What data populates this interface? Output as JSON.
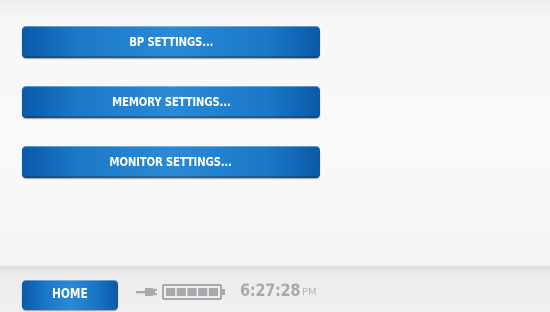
{
  "menu": {
    "bp_settings_label": "BP SETTINGS...",
    "memory_settings_label": "MEMORY SETTINGS...",
    "monitor_settings_label": "MONITOR SETTINGS..."
  },
  "footer": {
    "home_label": "HOME",
    "power_icon": "plug-icon",
    "battery_icon": "battery-icon",
    "battery_level_bars": 5,
    "battery_total_bars": 5,
    "time": "6:27:28",
    "ampm": "PM"
  },
  "colors": {
    "button_blue": "#1a78c7",
    "button_blue_dark": "#0a5aa8",
    "status_gray": "#a9a9ad",
    "background": "#f9f9fa"
  }
}
